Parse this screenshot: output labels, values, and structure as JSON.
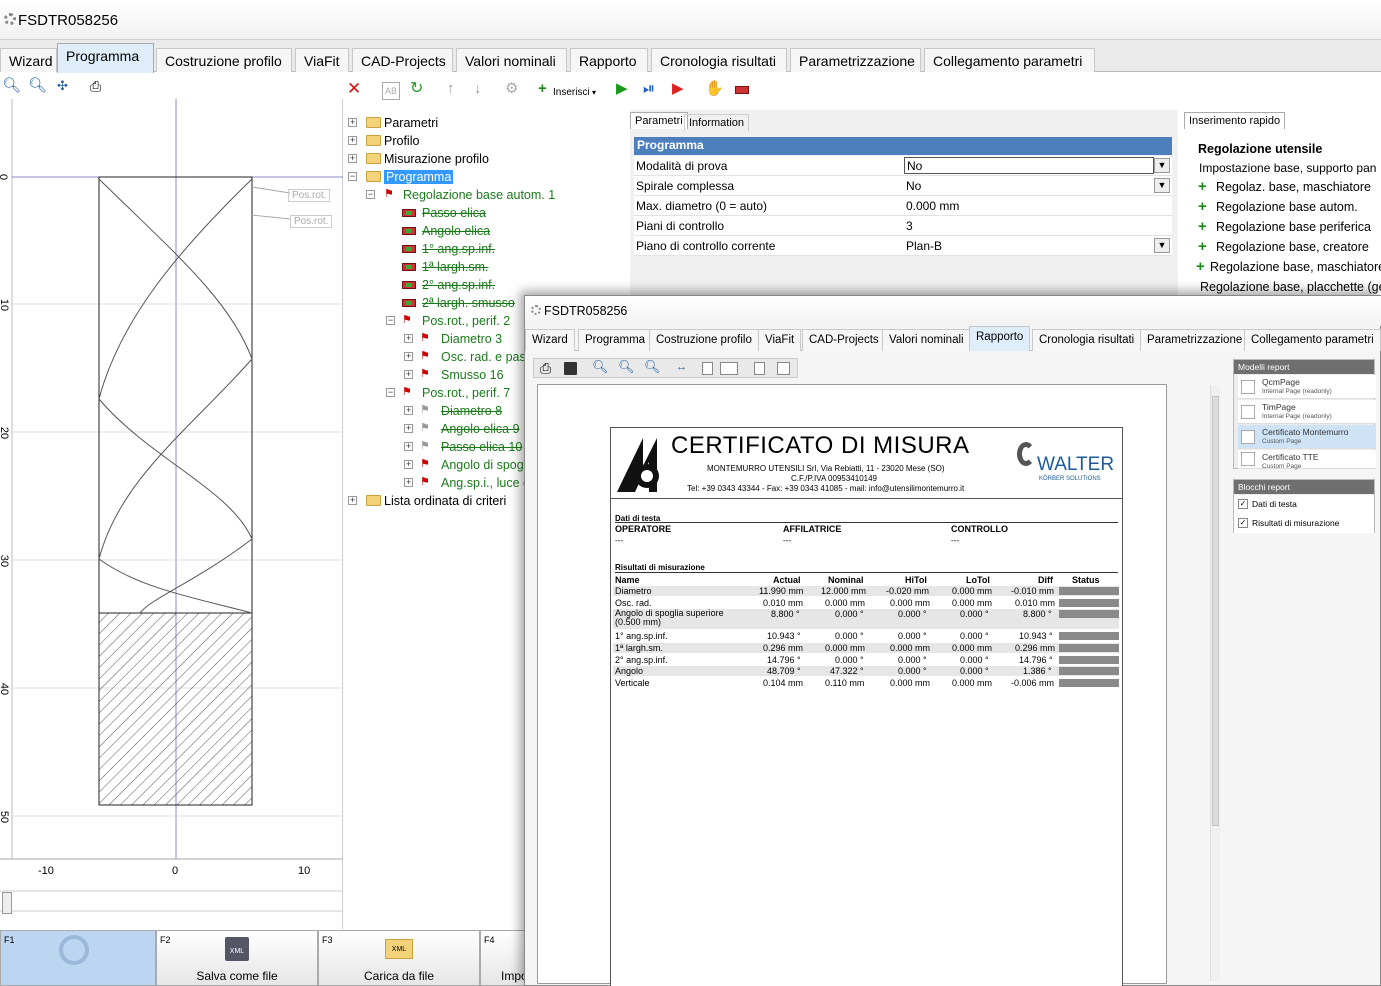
{
  "window": {
    "title": "FSDTR058256"
  },
  "tabs": [
    "Wizard",
    "Programma",
    "Costruzione profilo",
    "ViaFit",
    "CAD-Projects",
    "Valori nominali",
    "Rapporto",
    "Cronologia risultati",
    "Parametrizzazione",
    "Collegamento parametri"
  ],
  "toolbar": {
    "insert_label": "Inserisci"
  },
  "plot": {
    "y_ticks": [
      "0",
      "10",
      "20",
      "30",
      "40",
      "50"
    ],
    "x_ticks": [
      "-10",
      "0",
      "10"
    ],
    "pos_labels": [
      "Pos.rot.",
      "Pos.rot."
    ]
  },
  "tree": {
    "parametri": "Parametri",
    "profilo": "Profilo",
    "misurazione": "Misurazione profilo",
    "programma": "Programma",
    "reg_base": "Regolazione base autom. 1",
    "reg_children": [
      "Passo elica",
      "Angolo elica",
      "1° ang.sp.inf.",
      "1ª largh.sm.",
      "2° ang.sp.inf.",
      "2ª largh. smusso"
    ],
    "posrot2": "Pos.rot., perif. 2",
    "posrot2_children": [
      "Diametro 3",
      "Osc. rad. e pass",
      "Smusso 16"
    ],
    "posrot7": "Pos.rot., perif. 7",
    "posrot7_children": [
      "Diametro 8",
      "Angolo elica 9",
      "Passo elica 10",
      "Angolo di spogl",
      "Ang.sp.i., luce d"
    ],
    "lista": "Lista ordinata di criteri"
  },
  "props": {
    "tab_params": "Parametri",
    "tab_info": "Information",
    "header": "Programma",
    "rows": [
      {
        "k": "Modalità di prova",
        "v": "No"
      },
      {
        "k": "Spirale complessa",
        "v": "No"
      },
      {
        "k": "Max. diametro (0 = auto)",
        "v": "0.000 mm"
      },
      {
        "k": "Piani di controllo",
        "v": "3"
      },
      {
        "k": "Piano di controllo corrente",
        "v": "Plan-B"
      }
    ]
  },
  "quick": {
    "tab": "Inserimento rapido",
    "title": "Regolazione utensile",
    "sub": "Impostazione base, supporto pan",
    "items": [
      "Regolaz. base, maschiatore",
      "Regolazione base autom.",
      "Regolazione base periferica",
      "Regolazione base, creatore",
      "Regolazione base, maschiatore",
      "Regolazione base, placchette (ger"
    ]
  },
  "fkeys": [
    {
      "n": "F1",
      "l": ""
    },
    {
      "n": "F2",
      "l": "Salva come file"
    },
    {
      "n": "F3",
      "l": "Carica da file"
    },
    {
      "n": "F4",
      "l": "Impo"
    }
  ],
  "overlay": {
    "title": "FSDTR058256",
    "tabs": [
      "Wizard",
      "Programma",
      "Costruzione profilo",
      "ViaFit",
      "CAD-Projects",
      "Valori nominali",
      "Rapporto",
      "Cronologia risultati",
      "Parametrizzazione",
      "Collegamento parametri"
    ],
    "models_title": "Modelli report",
    "models": [
      {
        "t1": "QcmPage",
        "t2": "Internal Page (readonly)"
      },
      {
        "t1": "TimPage",
        "t2": "Internal Page (readonly)"
      },
      {
        "t1": "Certificato Montemurro",
        "t2": "Custom Page"
      },
      {
        "t1": "Certificato TTE",
        "t2": "Custom Page"
      }
    ],
    "blocks_title": "Blocchi report",
    "blocks": [
      "Dati di testa",
      "Risultati di misurazione"
    ]
  },
  "cert": {
    "title": "CERTIFICATO DI MISURA",
    "addr1": "MONTEMURRO UTENSILI Srl, Via Rebiatti, 11 - 23020 Mese (SO)",
    "addr2": "C.F./P.IVA 00953410149",
    "addr3": "Tel: +39 0343 43344 - Fax: +39 0343 41085 - mail: info@utensilimontemurro.it",
    "walter": "WALTER",
    "walter_sub": "KÖRBER SOLUTIONS",
    "head_section": "Dati di testa",
    "operatore": "OPERATORE",
    "affilatrice": "AFFILATRICE",
    "controllo": "CONTROLLO",
    "dash": "---",
    "results_section": "Risultati di misurazione",
    "cols": [
      "Name",
      "Actual",
      "Nominal",
      "HiTol",
      "LoTol",
      "Diff",
      "Status"
    ],
    "rows": [
      [
        "Diametro",
        "11.990 mm",
        "12.000 mm",
        "-0.020 mm",
        "0.000 mm",
        "-0.010 mm"
      ],
      [
        "Osc. rad.",
        "0.010 mm",
        "0.000 mm",
        "0.000 mm",
        "0.000 mm",
        "0.010 mm"
      ],
      [
        "Angolo di spoglia superiore (0.500 mm)",
        "8.800 °",
        "0.000 °",
        "0.000 °",
        "0.000 °",
        "8.800 °"
      ],
      [
        "1° ang.sp.inf.",
        "10.943 °",
        "0.000 °",
        "0.000 °",
        "0.000 °",
        "10.943 °"
      ],
      [
        "1ª largh.sm.",
        "0.296 mm",
        "0.000 mm",
        "0.000 mm",
        "0.000 mm",
        "0.296 mm"
      ],
      [
        "2° ang.sp.inf.",
        "14.796 °",
        "0.000 °",
        "0.000 °",
        "0.000 °",
        "14.796 °"
      ],
      [
        "Angolo",
        "48.709 °",
        "47.322 °",
        "0.000 °",
        "0.000 °",
        "1.386 °"
      ],
      [
        "Verticale",
        "0.104 mm",
        "0.110 mm",
        "0.000 mm",
        "0.000 mm",
        "-0.006 mm"
      ]
    ]
  }
}
